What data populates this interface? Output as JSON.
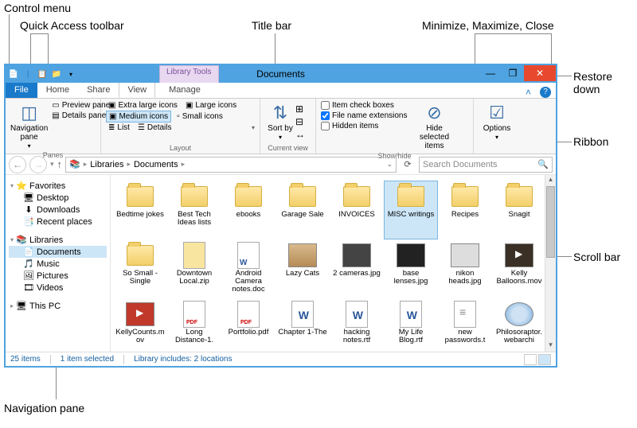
{
  "callouts": {
    "control_menu": "Control menu",
    "quick_access": "Quick Access toolbar",
    "title_bar": "Title bar",
    "win_controls": "Minimize, Maximize, Close",
    "restore_down": "Restore down",
    "ribbon": "Ribbon",
    "scroll_bar": "Scroll bar",
    "navigation_pane": "Navigation pane"
  },
  "titlebar": {
    "library_tools": "Library Tools",
    "title": "Documents"
  },
  "tabs": {
    "file": "File",
    "home": "Home",
    "share": "Share",
    "view": "View",
    "manage": "Manage"
  },
  "ribbon": {
    "panes": {
      "navigation_pane": "Navigation pane",
      "preview_pane": "Preview pane",
      "details_pane": "Details pane",
      "group": "Panes"
    },
    "layout": {
      "extra_large": "Extra large icons",
      "large": "Large icons",
      "medium": "Medium icons",
      "small": "Small icons",
      "list": "List",
      "details": "Details",
      "group": "Layout"
    },
    "current_view": {
      "sort_by": "Sort by",
      "group": "Current view"
    },
    "show_hide": {
      "item_check": "Item check boxes",
      "file_ext": "File name extensions",
      "hidden": "Hidden items",
      "hide_selected": "Hide selected items",
      "group": "Show/hide"
    },
    "options": "Options"
  },
  "address": {
    "root": "Libraries",
    "current": "Documents"
  },
  "search": {
    "placeholder": "Search Documents"
  },
  "navpane": {
    "favorites": "Favorites",
    "desktop": "Desktop",
    "downloads": "Downloads",
    "recent": "Recent places",
    "libraries": "Libraries",
    "documents": "Documents",
    "music": "Music",
    "pictures": "Pictures",
    "videos": "Videos",
    "this_pc": "This PC"
  },
  "items": [
    {
      "name": "Bedtime jokes",
      "type": "folder"
    },
    {
      "name": "Best Tech Ideas lists",
      "type": "folder"
    },
    {
      "name": "ebooks",
      "type": "folder"
    },
    {
      "name": "Garage Sale",
      "type": "folder"
    },
    {
      "name": "INVOICES",
      "type": "folder"
    },
    {
      "name": "MISC writings",
      "type": "folder",
      "selected": true
    },
    {
      "name": "Recipes",
      "type": "folder"
    },
    {
      "name": "Snagit",
      "type": "folder"
    },
    {
      "name": "So Small - Single",
      "type": "folder"
    },
    {
      "name": "Downtown Local.zip",
      "type": "zip"
    },
    {
      "name": "Android Camera notes.doc",
      "type": "doc"
    },
    {
      "name": "Lazy Cats",
      "type": "img-box"
    },
    {
      "name": "2 cameras.jpg",
      "type": "img-cam"
    },
    {
      "name": "base lenses.jpg",
      "type": "img-lens"
    },
    {
      "name": "nikon heads.jpg",
      "type": "img-nikon"
    },
    {
      "name": "Kelly Balloons.mov",
      "type": "mov-balloon"
    },
    {
      "name": "KellyCounts.mov",
      "type": "mov-kelly"
    },
    {
      "name": "Long Distance-1.",
      "type": "pdf"
    },
    {
      "name": "Portfolio.pdf",
      "type": "pdf"
    },
    {
      "name": "Chapter 1-The",
      "type": "rtf"
    },
    {
      "name": "hacking notes.rtf",
      "type": "rtf"
    },
    {
      "name": "My Life Blog.rtf",
      "type": "rtf"
    },
    {
      "name": "new passwords.t",
      "type": "txt"
    },
    {
      "name": "Philosoraptor.webarchi",
      "type": "webarchive"
    }
  ],
  "status": {
    "count": "25 items",
    "selected": "1 item selected",
    "library": "Library includes: 2 locations"
  }
}
